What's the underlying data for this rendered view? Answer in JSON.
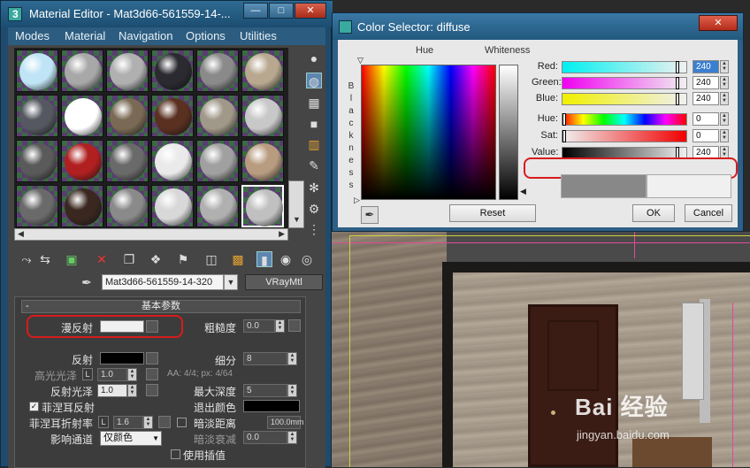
{
  "material_editor": {
    "title": "Material Editor - Mat3d66-561559-14-...",
    "menu": [
      "Modes",
      "Material",
      "Navigation",
      "Options",
      "Utilities"
    ],
    "window_buttons": [
      "—",
      "□",
      "✕"
    ],
    "material_name": "Mat3d66-561559-14-320",
    "material_type": "VRayMtl",
    "rollout_title": "基本参数",
    "rollout_toggle": "-",
    "diffuse_label": "漫反射",
    "roughness_label": "粗糙度",
    "roughness_value": "0.0",
    "reflect_label": "反射",
    "subdivs_label": "细分",
    "subdivs_value": "8",
    "hilight_gloss_label": "高光光泽",
    "hilight_gloss_value": "1.0",
    "aa_text": "AA: 4/4; px: 4/64",
    "refl_gloss_label": "反射光泽",
    "refl_gloss_value": "1.0",
    "max_depth_label": "最大深度",
    "max_depth_value": "5",
    "fresnel_label": "菲涅耳反射",
    "fresnel_checked": true,
    "exit_color_label": "退出颜色",
    "fresnel_ior_label": "菲涅耳折射率",
    "fresnel_ior_value": "1.6",
    "lock_label": "L",
    "dim_distance_label": "暗淡距离",
    "dim_distance_value": "100.0mm",
    "affect_channels_label": "影响通道",
    "affect_channels_value": "仅颜色",
    "dim_falloff_label": "暗淡衰减",
    "dim_falloff_value": "0.0",
    "use_interp_label": "使用插值",
    "colors": {
      "diffuse_swatch": "#f0f0f0",
      "reflect_swatch": "#000000",
      "exit_color_swatch": "#000000",
      "highlight": "#d81b1b"
    },
    "side_tool_icons": [
      "sample-type-icon",
      "backlight-icon",
      "background-icon",
      "tiling-icon",
      "video-check-icon",
      "make-preview-icon",
      "options-icon",
      "select-by-material-icon",
      "material-navigator-icon"
    ],
    "bottom_tool_icons": [
      "get-material-icon",
      "put-to-scene-icon",
      "assign-to-selection-icon",
      "reset-map-icon",
      "copy-material-icon",
      "make-unique-icon",
      "put-to-library-icon",
      "material-id-icon",
      "show-in-viewport-icon",
      "show-end-result-icon",
      "go-to-parent-icon",
      "go-forward-icon"
    ],
    "slot_materials": [
      "#bfe4f5",
      "#a8a8a8",
      "#b0b0b0",
      "#2a2a30",
      "#8a8a8a",
      "#b8a890",
      "#555860",
      "#ffffff",
      "#7a6a55",
      "#5a3020",
      "#a09888",
      "#c8c8c8",
      "#5a5a5a",
      "#b02020",
      "#6a6a6a",
      "#eaeaea",
      "#a0a0a0",
      "#b89c80",
      "#6a6a6a",
      "#3a2820",
      "#8a8a8a",
      "#d8d8d8",
      "#b0b0b0",
      "#c0c0c0"
    ]
  },
  "color_selector": {
    "title": "Color Selector: diffuse",
    "close": "✕",
    "hue_label": "Hue",
    "whiteness_label": "Whiteness",
    "blackness_letters": [
      "B",
      "l",
      "a",
      "c",
      "k",
      "n",
      "e",
      "s",
      "s"
    ],
    "sliders": [
      {
        "label": "Red:",
        "value": "240",
        "highlighted": true
      },
      {
        "label": "Green:",
        "value": "240",
        "highlighted": false
      },
      {
        "label": "Blue:",
        "value": "240",
        "highlighted": false
      },
      {
        "label": "Hue:",
        "value": "0",
        "highlighted": false
      },
      {
        "label": "Sat:",
        "value": "0",
        "highlighted": false
      },
      {
        "label": "Value:",
        "value": "240",
        "highlighted": false
      }
    ],
    "reset_label": "Reset",
    "ok_label": "OK",
    "cancel_label": "Cancel",
    "old_color": "#888888",
    "new_color": "#f0f0f0"
  },
  "watermark": {
    "brand": "Bai 经验",
    "url": "jingyan.baidu.com"
  }
}
